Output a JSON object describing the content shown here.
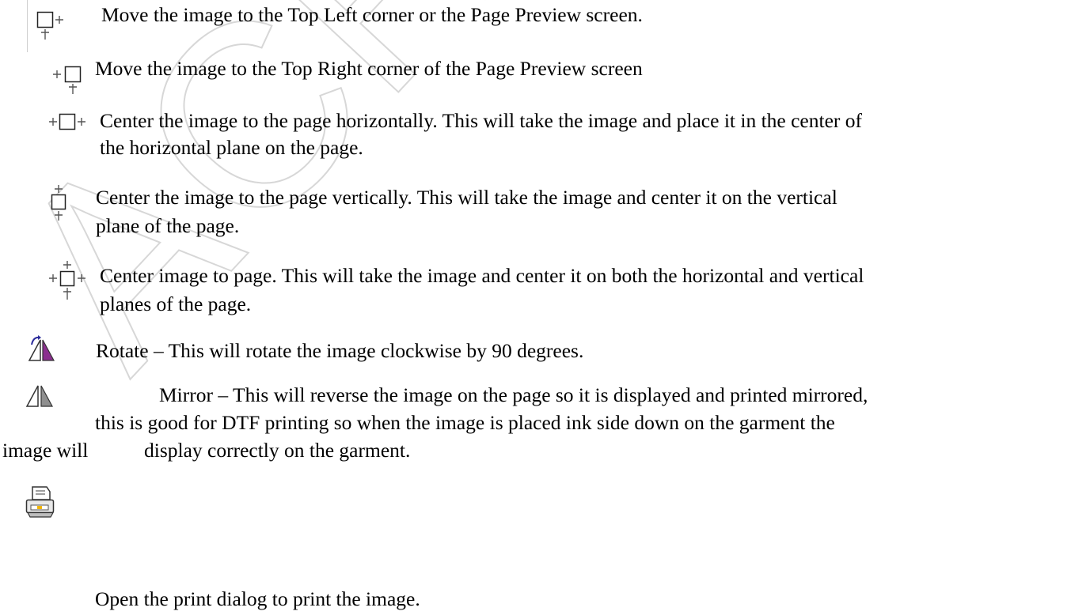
{
  "watermark": "ACRORIP",
  "items": [
    {
      "icon": "align-top-left-icon",
      "lines": [
        "Move the image to the Top Left corner or the Page Preview screen."
      ]
    },
    {
      "icon": "align-top-right-icon",
      "lines": [
        "Move the image to the Top Right corner of the Page Preview screen"
      ]
    },
    {
      "icon": "center-horizontal-icon",
      "lines": [
        "Center the image to the page horizontally. This will take the image and place it in the center of",
        "the horizontal plane on the page."
      ]
    },
    {
      "icon": "center-vertical-icon",
      "lines": [
        "Center the image to the page vertically. This will take the image and center it on the vertical",
        "plane of the page."
      ]
    },
    {
      "icon": "center-both-icon",
      "lines": [
        "Center image to page. This will take the image and center it on both the horizontal and vertical",
        "planes of the page."
      ]
    },
    {
      "icon": "rotate-icon",
      "lines": [
        "Rotate – This will rotate the image clockwise by 90 degrees."
      ]
    },
    {
      "icon": "mirror-icon",
      "lines": [
        "Mirror – This will reverse the image on the page so it is displayed and printed mirrored,",
        "this is good for DTF printing so when the image is placed ink side down on the garment the",
        "image will",
        "display correctly on the garment."
      ]
    },
    {
      "icon": "printer-icon",
      "lines": [
        "Open the print dialog to print the image."
      ]
    }
  ]
}
